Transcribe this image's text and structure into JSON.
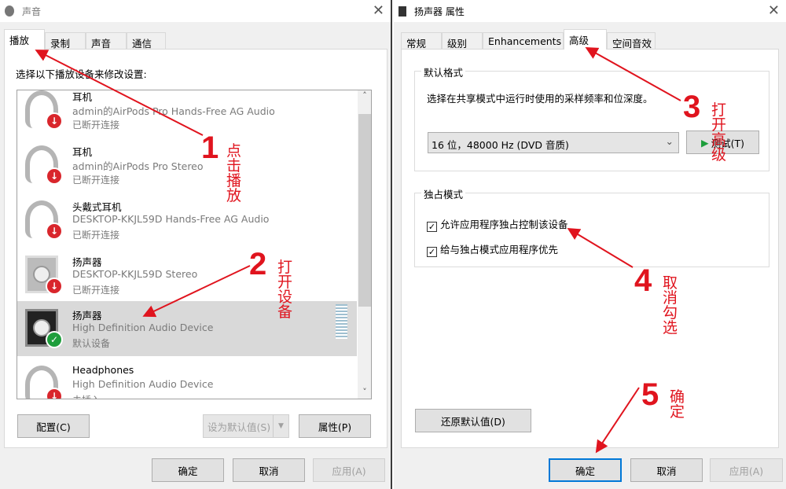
{
  "left_window": {
    "title": "声音",
    "tabs": [
      "播放",
      "录制",
      "声音",
      "通信"
    ],
    "instruction": "选择以下播放设备来修改设置:",
    "devices": [
      {
        "name": "耳机",
        "desc": "admin的AirPods Pro Hands-Free AG Audio",
        "status": "已断开连接",
        "icon": "headset-icon",
        "badge": "disconnected"
      },
      {
        "name": "耳机",
        "desc": "admin的AirPods Pro Stereo",
        "status": "已断开连接",
        "icon": "headphones-icon",
        "badge": "disconnected"
      },
      {
        "name": "头戴式耳机",
        "desc": "DESKTOP-KKJL59D Hands-Free AG Audio",
        "status": "已断开连接",
        "icon": "headset-icon",
        "badge": "disconnected"
      },
      {
        "name": "扬声器",
        "desc": "DESKTOP-KKJL59D Stereo",
        "status": "已断开连接",
        "icon": "speaker-icon",
        "badge": "disconnected"
      },
      {
        "name": "扬声器",
        "desc": "High Definition Audio Device",
        "status": "默认设备",
        "icon": "speaker-icon",
        "badge": "default",
        "selected": true
      },
      {
        "name": "Headphones",
        "desc": "High Definition Audio Device",
        "status": "未插入",
        "icon": "headphones-icon",
        "badge": "unplugged"
      }
    ],
    "configure_button": "配置(C)",
    "set_default_button": "设为默认值(S)",
    "properties_button": "属性(P)",
    "ok": "确定",
    "cancel": "取消",
    "apply": "应用(A)"
  },
  "right_window": {
    "title": "扬声器 属性",
    "tabs": [
      "常规",
      "级别",
      "Enhancements",
      "高级",
      "空间音效"
    ],
    "default_format": {
      "label": "默认格式",
      "desc": "选择在共享模式中运行时使用的采样频率和位深度。",
      "selected_format": "16 位，48000 Hz (DVD 音质)",
      "test_button": "测试(T)"
    },
    "exclusive_mode": {
      "label": "独占模式",
      "allow_exclusive": "允许应用程序独占控制该设备",
      "allow_exclusive_checked": true,
      "priority": "给与独占模式应用程序优先",
      "priority_checked": true
    },
    "restore_defaults": "还原默认值(D)",
    "ok": "确定",
    "cancel": "取消",
    "apply": "应用(A)"
  },
  "annotations": [
    {
      "num": "1",
      "text": "点击播放"
    },
    {
      "num": "2",
      "text": "打开设备"
    },
    {
      "num": "3",
      "text": "打开高级"
    },
    {
      "num": "4",
      "text": "取消勾选"
    },
    {
      "num": "5",
      "text": "确定"
    }
  ],
  "colors": {
    "annotation": "#e0141e",
    "accent": "#0078d7",
    "default_badge": "#1e9e3c",
    "disconnected_badge": "#d9262c"
  }
}
